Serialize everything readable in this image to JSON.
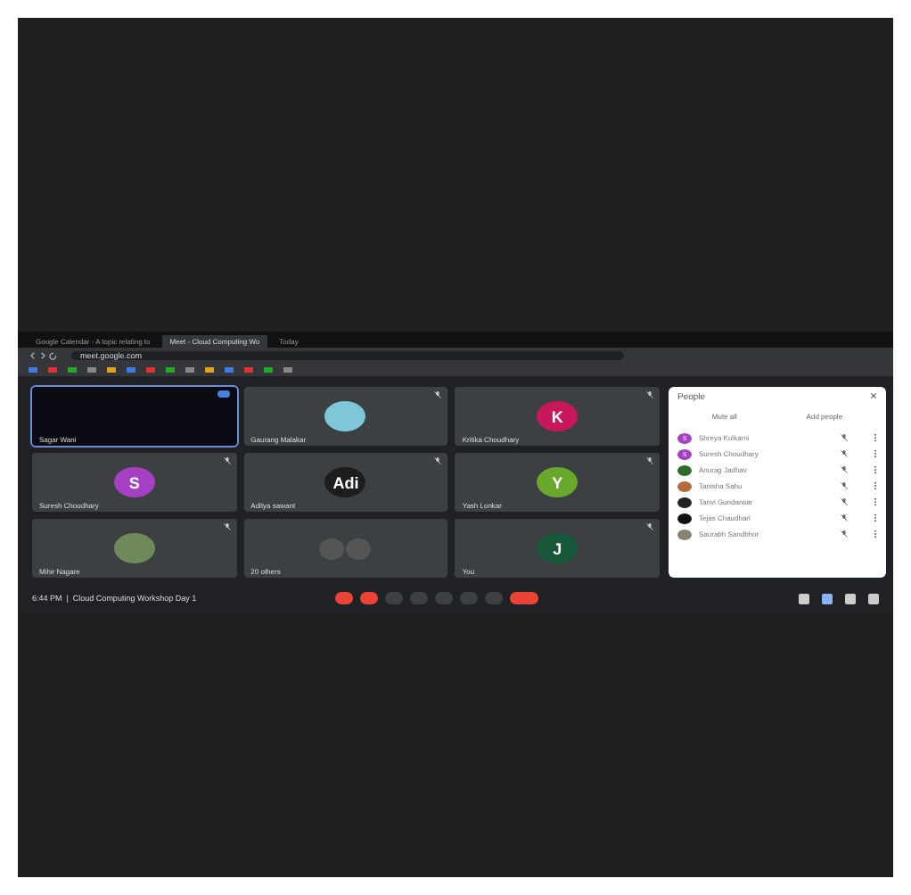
{
  "browser": {
    "tabs": [
      {
        "label": "Google Calendar - A topic relating to",
        "selected": false
      },
      {
        "label": "Meet - Cloud Computing Wo",
        "selected": true
      },
      {
        "label": "Today",
        "selected": false
      }
    ],
    "url": "meet.google.com"
  },
  "tiles": [
    {
      "name": "Sagar Wani",
      "kind": "blank",
      "speaking": true,
      "muted": false
    },
    {
      "name": "Gaurang Malakar",
      "kind": "photo",
      "speaking": false,
      "muted": true,
      "color": "#7fc6d9"
    },
    {
      "name": "Kritika Choudhary",
      "kind": "initial",
      "initial": "K",
      "speaking": false,
      "muted": true,
      "color": "#c8175a"
    },
    {
      "name": "Suresh Choudhary",
      "kind": "initial",
      "initial": "S",
      "speaking": false,
      "muted": true,
      "color": "#a640c2"
    },
    {
      "name": "Aditya sawant",
      "kind": "initial",
      "initial": "Adi",
      "speaking": false,
      "muted": true,
      "color": "#1d1d1d"
    },
    {
      "name": "Yash Lonkar",
      "kind": "initial",
      "initial": "Y",
      "speaking": false,
      "muted": true,
      "color": "#6aa82c"
    },
    {
      "name": "Mihir Nagare",
      "kind": "photo",
      "speaking": false,
      "muted": true,
      "color": "#6f8a5a"
    },
    {
      "name": "20 others",
      "kind": "group",
      "speaking": false,
      "muted": false,
      "color": "#555555"
    },
    {
      "name": "You",
      "kind": "initial",
      "initial": "J",
      "speaking": false,
      "muted": true,
      "color": "#17583a"
    }
  ],
  "people": {
    "title": "People",
    "actions": [
      "Mute all",
      "Add people"
    ],
    "members": [
      {
        "name": "Shreya Kulkarni",
        "initial": "S",
        "color": "#a640c2"
      },
      {
        "name": "Suresh Choudhary",
        "initial": "S",
        "color": "#a640c2"
      },
      {
        "name": "Anurag Jadhav",
        "color": "#2e6b2a"
      },
      {
        "name": "Tanisha Sahu",
        "color": "#b46a3a"
      },
      {
        "name": "Tanvi Gundarwar",
        "color": "#222222"
      },
      {
        "name": "Tejas Chaudhari",
        "color": "#111111"
      },
      {
        "name": "Saurabh Sandbhor",
        "color": "#8a8170"
      }
    ]
  },
  "meeting": {
    "time": "6:44 PM",
    "separator": "|",
    "title": "Cloud Computing Workshop Day 1"
  }
}
